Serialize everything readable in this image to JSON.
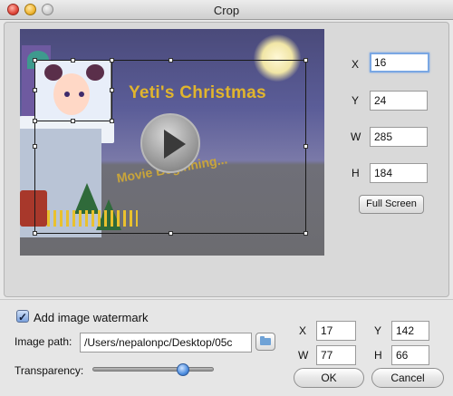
{
  "window": {
    "title": "Crop"
  },
  "preview": {
    "video_title": "Yeti's Christmas",
    "movie_text": "Movie Beginning..."
  },
  "crop": {
    "x_label": "X",
    "x_value": "16",
    "y_label": "Y",
    "y_value": "24",
    "w_label": "W",
    "w_value": "285",
    "h_label": "H",
    "h_value": "184",
    "full_screen_label": "Full Screen"
  },
  "watermark": {
    "add_label": "Add image watermark",
    "enabled": true,
    "path_label": "Image path:",
    "path_value": "/Users/nepalonpc/Desktop/05c",
    "transparency_label": "Transparency:",
    "transparency": 0.75,
    "x_label": "X",
    "x_value": "17",
    "y_label": "Y",
    "y_value": "142",
    "w_label": "W",
    "w_value": "77",
    "h_label": "H",
    "h_value": "66"
  },
  "buttons": {
    "ok": "OK",
    "cancel": "Cancel"
  },
  "icons": {
    "folder": "folder-icon",
    "play": "play-icon"
  }
}
